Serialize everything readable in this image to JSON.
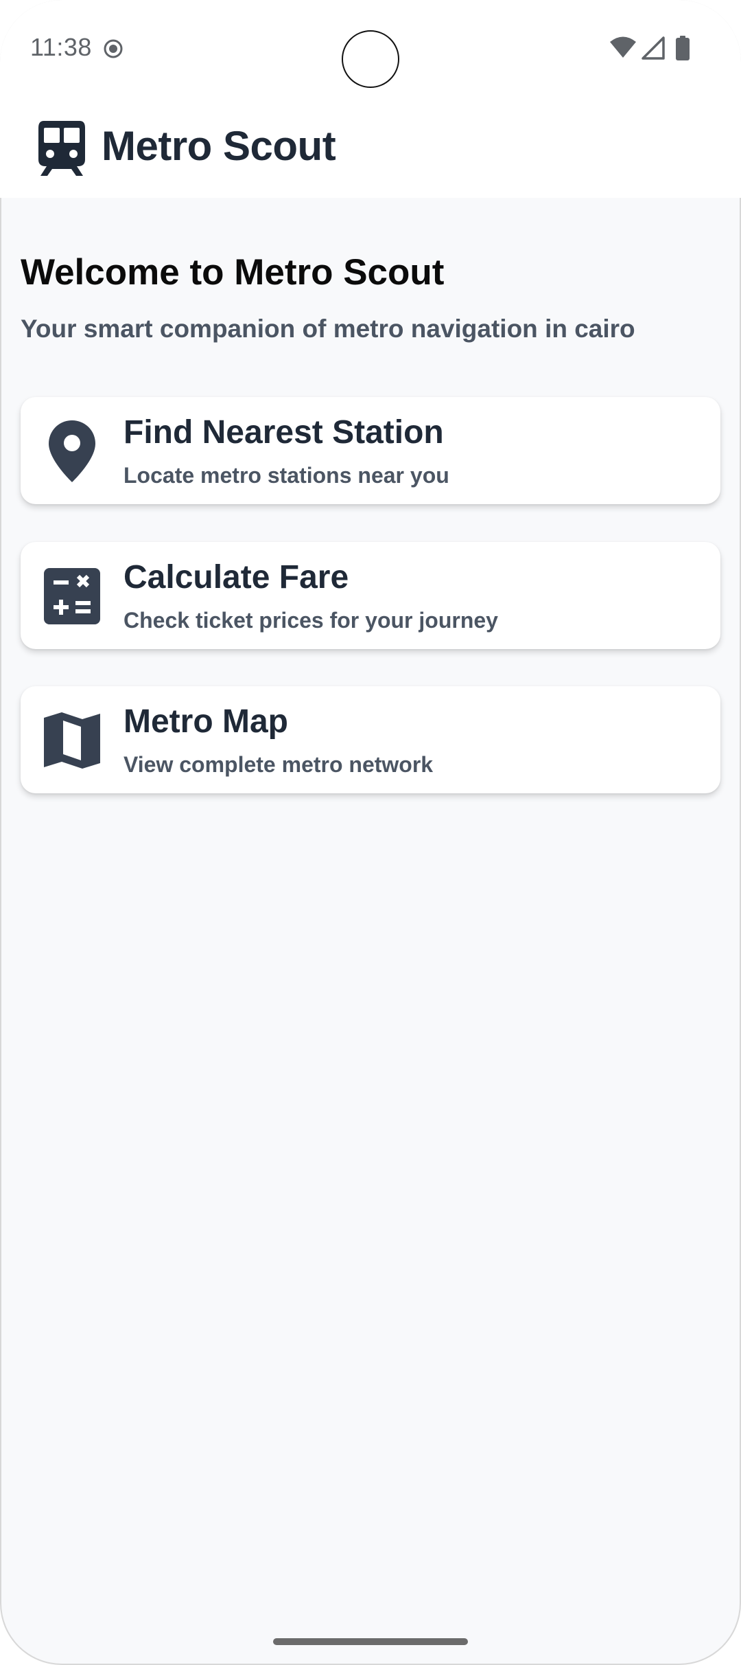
{
  "status_bar": {
    "time": "11:38",
    "icons": [
      "screen-record-icon",
      "wifi-icon",
      "signal-icon",
      "battery-icon"
    ]
  },
  "app_bar": {
    "title": "Metro Scout",
    "logo_icon": "train-icon"
  },
  "welcome": {
    "title": "Welcome to Metro Scout",
    "subtitle": "Your smart companion of metro navigation in cairo"
  },
  "cards": [
    {
      "title": "Find Nearest Station",
      "subtitle": "Locate metro stations near you",
      "icon": "location-pin-icon"
    },
    {
      "title": "Calculate Fare",
      "subtitle": "Check ticket prices for your journey",
      "icon": "calculator-icon"
    },
    {
      "title": "Metro Map",
      "subtitle": "View complete metro network",
      "icon": "map-icon"
    }
  ],
  "colors": {
    "primary_text": "#1f2937",
    "secondary_text": "#4b5563",
    "icon": "#374151",
    "background": "#f8f9fb",
    "surface": "#ffffff"
  }
}
